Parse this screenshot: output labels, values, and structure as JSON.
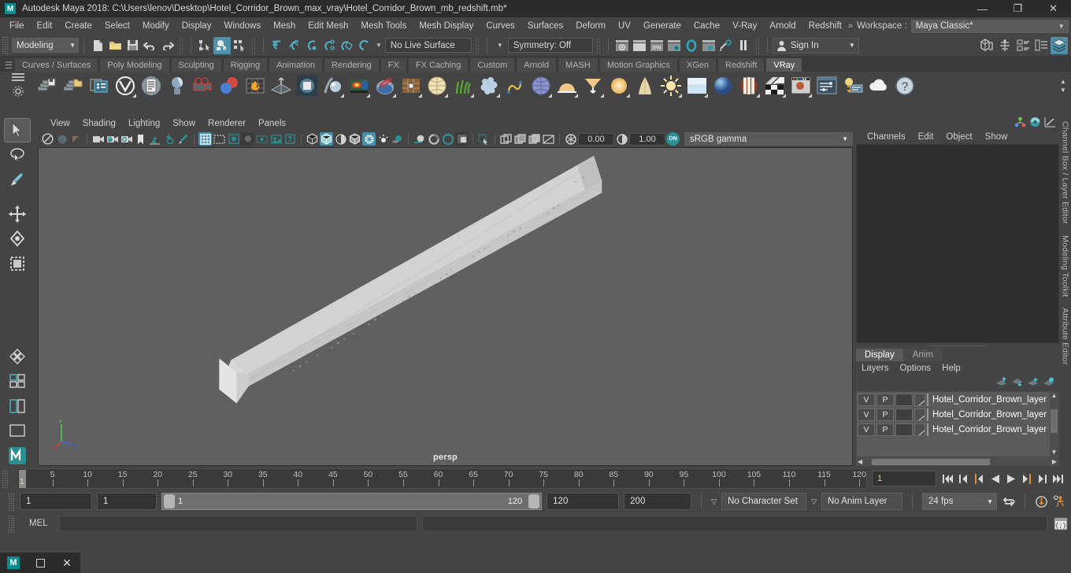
{
  "window": {
    "app_name": "Autodesk Maya 2018",
    "title": "Autodesk Maya 2018: C:\\Users\\lenov\\Desktop\\Hotel_Corridor_Brown_max_vray\\Hotel_Corridor_Brown_mb_redshift.mb*",
    "logo_text": "M",
    "minimize": "—",
    "maximize": "❐",
    "close": "✕"
  },
  "menubar": {
    "items": [
      "File",
      "Edit",
      "Create",
      "Select",
      "Modify",
      "Display",
      "Windows",
      "Mesh",
      "Edit Mesh",
      "Mesh Tools",
      "Mesh Display",
      "Curves",
      "Surfaces",
      "Deform",
      "UV",
      "Generate",
      "Cache",
      "V-Ray",
      "Arnold",
      "Redshift"
    ],
    "overflow_icon": "»",
    "workspace_label": "Workspace :",
    "workspace_value": "Maya Classic*",
    "lock_icon": "lock-icon"
  },
  "statusline": {
    "menu_set": "Modeling",
    "live_surface": "No Live Surface",
    "symmetry": "Symmetry: Off",
    "signin": "Sign In"
  },
  "shelf": {
    "tabs": [
      "Curves / Surfaces",
      "Poly Modeling",
      "Sculpting",
      "Rigging",
      "Animation",
      "Rendering",
      "FX",
      "FX Caching",
      "Custom",
      "Arnold",
      "MASH",
      "Motion Graphics",
      "XGen",
      "Redshift",
      "VRay"
    ],
    "active_tab": "VRay",
    "icons": [
      "vray-render-save-icon",
      "vray-render-folder-icon",
      "vray-frame-buffer-icon",
      "vray-logo-icon",
      "vray-render-settings-icon",
      "vray-material-icon",
      "vray-camera-icon",
      "vray-material-blend-icon",
      "vray-volume-grid-icon",
      "vray-plane-icon",
      "vray-light-rect-icon",
      "vray-sphere-icon",
      "vray-light-dome-icon",
      "vray-light-mesh-icon",
      "vray-displacement-icon",
      "vray-proxy-icon",
      "vray-clipper-icon",
      "vray-mtl-grid-icon",
      "vray-sphere-fade-icon",
      "vray-fur-icon",
      "vray-scatter-icon",
      "vray-curve-icon",
      "vray-globe-icon",
      "vray-dome-light-icon",
      "vray-ies-light-icon",
      "vray-sphere-light-icon",
      "vray-light-ambient-icon",
      "vray-sun-icon",
      "vray-sky-icon",
      "vray-env-sphere-icon",
      "vray-toon-icon",
      "vray-checker-icon",
      "vray-render-view-icon",
      "vray-attributes-icon",
      "vray-light-lister-icon",
      "vray-cloud-icon",
      "vray-help-icon"
    ]
  },
  "toolbox": {
    "tools": [
      "select-tool",
      "lasso-select-tool",
      "paint-select-tool",
      "move-tool",
      "rotate-tool",
      "scale-tool",
      "last-tool-icon",
      "four-view-layout-icon",
      "two-pane-layout-icon",
      "single-pane-layout-icon",
      "maya-embedded-language-icon"
    ]
  },
  "viewport": {
    "menus": [
      "View",
      "Shading",
      "Lighting",
      "Show",
      "Renderer",
      "Panels"
    ],
    "exposure_value": "0.00",
    "gamma_value": "1.00",
    "color_management": "sRGB gamma",
    "gamma_toggle": "ON",
    "camera_label": "persp",
    "axis_labels": {
      "x": "x",
      "y": "y",
      "z": "z"
    }
  },
  "channel_box": {
    "panel_title": "Channel Box / Layer Editor",
    "menus": [
      "Channels",
      "Edit",
      "Object",
      "Show"
    ],
    "top_icons": [
      "channel-box-icon",
      "attribute-editor-icon",
      "graph-editor-icon"
    ],
    "side_tabs": [
      "Channel Box / Layer Editor",
      "Modeling Toolkit",
      "Attribute Editor"
    ]
  },
  "layer_editor": {
    "tabs": [
      "Display",
      "Anim"
    ],
    "active_tab": "Display",
    "menus": [
      "Layers",
      "Options",
      "Help"
    ],
    "action_icons": [
      "move-layer-up-icon",
      "move-layer-down-icon",
      "new-layer-icon",
      "new-layer-from-selected-icon"
    ],
    "columns": {
      "visibility": "V",
      "playback": "P"
    },
    "rows": [
      {
        "v": "V",
        "p": "P",
        "name": "Hotel_Corridor_Brown_layer"
      },
      {
        "v": "V",
        "p": "P",
        "name": "Hotel_Corridor_Brown_layer"
      },
      {
        "v": "V",
        "p": "P",
        "name": "Hotel_Corridor_Brown_layer"
      }
    ]
  },
  "timeline": {
    "ticks": [
      5,
      10,
      15,
      20,
      25,
      30,
      35,
      40,
      45,
      50,
      55,
      60,
      65,
      70,
      75,
      80,
      85,
      90,
      95,
      100,
      105,
      110,
      115,
      120
    ],
    "current_frame_marker": "1",
    "current_frame_field": "1",
    "transport_icons": [
      "go-to-start-icon",
      "step-back-keyframe-icon",
      "step-back-frame-icon",
      "play-backwards-icon",
      "play-forwards-icon",
      "step-forward-frame-icon",
      "step-forward-keyframe-icon",
      "go-to-end-icon"
    ]
  },
  "range_slider": {
    "anim_start": "1",
    "range_start": "1",
    "bar_start_label": "1",
    "bar_end_label": "120",
    "range_end": "120",
    "anim_end": "200",
    "character_set": "No Character Set",
    "anim_layer": "No Anim Layer",
    "fps": "24 fps",
    "auto_key_icon": "auto-key-icon",
    "anim_prefs_icon": "animation-preferences-icon",
    "loop_icon": "playback-loop-icon"
  },
  "command_line": {
    "language_label": "MEL",
    "input_value": "",
    "output_value": "",
    "script_editor_icon": "script-editor-icon"
  },
  "taskbar": {
    "items": [
      "maya-taskbar-icon",
      "window-restore-icon",
      "close-window-icon"
    ]
  },
  "colors": {
    "accent": "#4d8fa6",
    "panel_bg": "#444444",
    "titlebar_bg": "#2b2b2b",
    "viewport_bg": "#606060",
    "orange": "#e08a3c"
  }
}
